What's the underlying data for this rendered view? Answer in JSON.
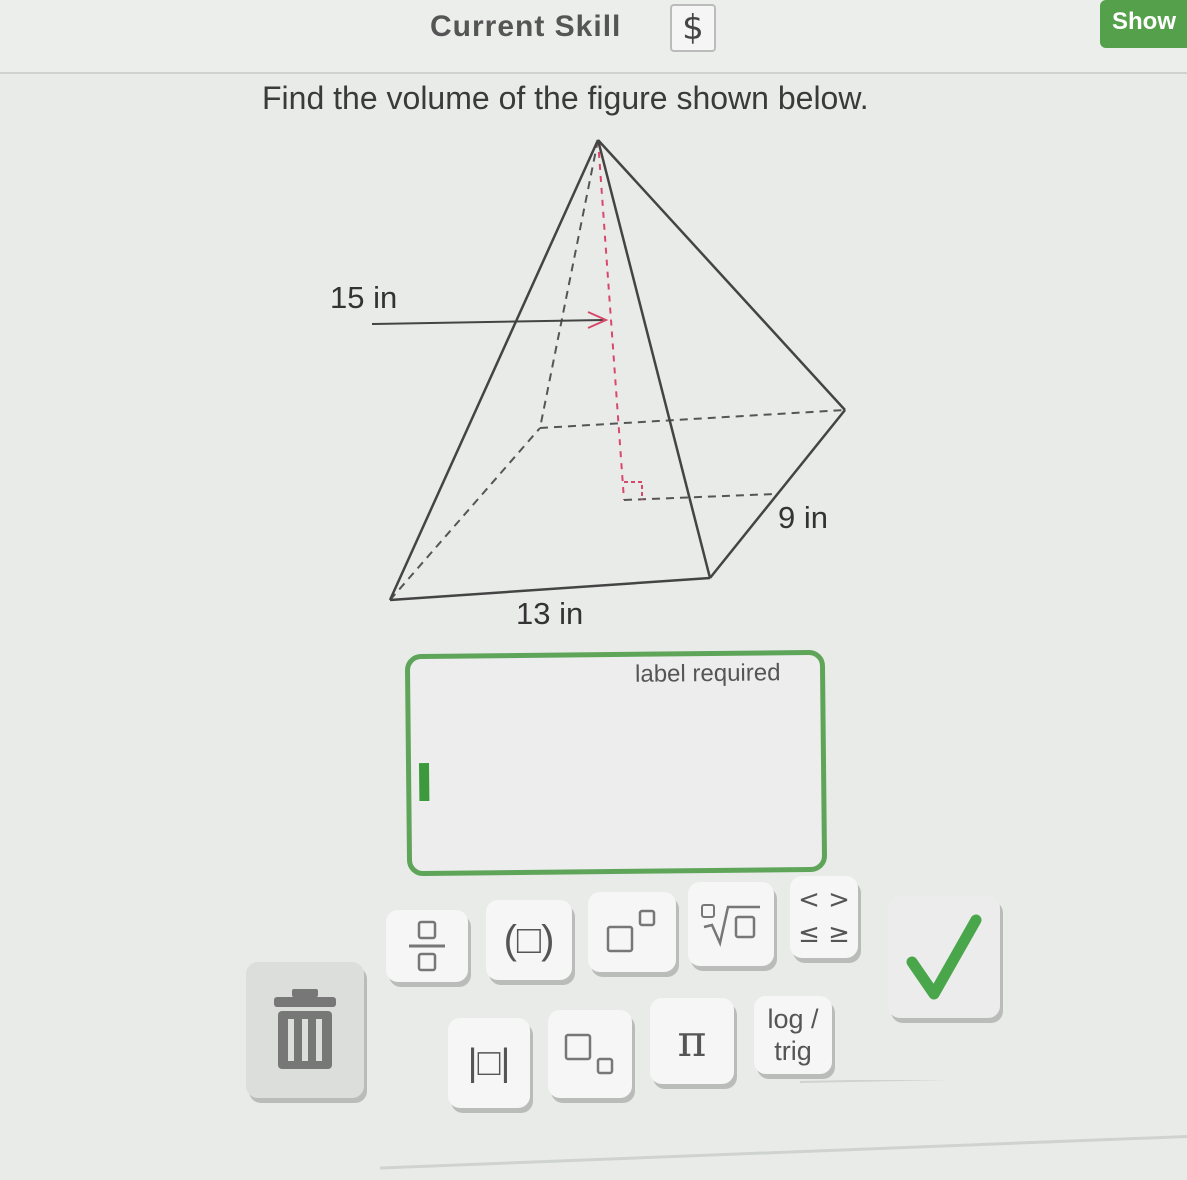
{
  "header": {
    "skill_label": "Current Skill",
    "skill_badge": "$",
    "show_label": "Show"
  },
  "question": {
    "prompt": "Find the volume of the figure shown below."
  },
  "figure": {
    "type": "rectangular-pyramid",
    "height_label": "15 in",
    "depth_label": "9 in",
    "width_label": "13 in"
  },
  "answer": {
    "placeholder": "label required",
    "value": ""
  },
  "keypad": {
    "keys": [
      {
        "name": "trash",
        "icon": "trash-icon"
      },
      {
        "name": "fraction",
        "icon": "fraction-icon"
      },
      {
        "name": "parentheses",
        "label": "(□)"
      },
      {
        "name": "exponent",
        "icon": "exponent-icon"
      },
      {
        "name": "nth-root",
        "icon": "root-icon"
      },
      {
        "name": "inequalities",
        "lines": [
          "< >",
          "≤ ≥"
        ]
      },
      {
        "name": "absolute-value",
        "label": "|□|"
      },
      {
        "name": "subscript",
        "icon": "subscript-icon"
      },
      {
        "name": "pi",
        "label": "π"
      },
      {
        "name": "log-trig",
        "lines": [
          "log /",
          "trig"
        ]
      },
      {
        "name": "submit",
        "icon": "check-icon"
      }
    ]
  },
  "colors": {
    "accent_green": "#5ea55a",
    "height_marker": "#d9486a"
  }
}
